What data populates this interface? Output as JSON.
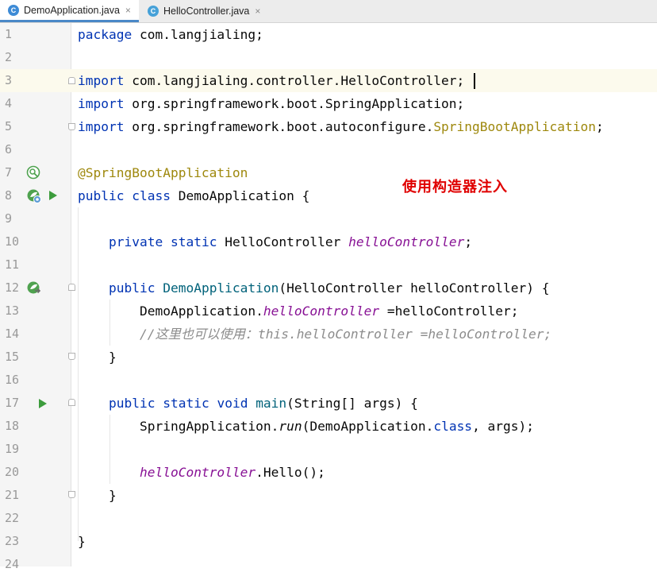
{
  "tabs": [
    {
      "label": "DemoApplication.java",
      "active": true,
      "icon": "spring-boot-class-icon",
      "close": "×"
    },
    {
      "label": "HelloController.java",
      "active": false,
      "icon": "java-class-icon",
      "close": "×"
    }
  ],
  "colors": {
    "keyword": "#0033b3",
    "annotation": "#9e880d",
    "field": "#871094",
    "method": "#00627a",
    "comment": "#8c8c8c",
    "note": "#e00000",
    "spring_icon": "#4fa24f",
    "run_icon": "#3c9c3c"
  },
  "editor": {
    "current_line": 3,
    "lines": [
      {
        "n": "1",
        "segs": [
          {
            "t": "package",
            "c": "kw"
          },
          {
            "t": " com.langjialing;"
          }
        ]
      },
      {
        "n": "2",
        "segs": []
      },
      {
        "n": "3",
        "segs": [
          {
            "t": "import",
            "c": "kw"
          },
          {
            "t": " com.langjialing.controller.HelloController;"
          }
        ]
      },
      {
        "n": "4",
        "segs": [
          {
            "t": "import",
            "c": "kw"
          },
          {
            "t": " org.springframework.boot.SpringApplication;"
          }
        ]
      },
      {
        "n": "5",
        "segs": [
          {
            "t": "import",
            "c": "kw"
          },
          {
            "t": " org.springframework.boot.autoconfigure."
          },
          {
            "t": "SpringBootApplication",
            "c": "ann"
          },
          {
            "t": ";"
          }
        ]
      },
      {
        "n": "6",
        "segs": []
      },
      {
        "n": "7",
        "segs": [
          {
            "t": "@SpringBootApplication",
            "c": "ann"
          }
        ]
      },
      {
        "n": "8",
        "segs": [
          {
            "t": "public",
            "c": "kw"
          },
          {
            "t": " "
          },
          {
            "t": "class",
            "c": "kw"
          },
          {
            "t": " DemoApplication {"
          }
        ]
      },
      {
        "n": "9",
        "segs": []
      },
      {
        "n": "10",
        "segs": [
          {
            "t": "    "
          },
          {
            "t": "private",
            "c": "kw"
          },
          {
            "t": " "
          },
          {
            "t": "static",
            "c": "kw"
          },
          {
            "t": " HelloController "
          },
          {
            "t": "helloController",
            "c": "fld"
          },
          {
            "t": ";"
          }
        ]
      },
      {
        "n": "11",
        "segs": []
      },
      {
        "n": "12",
        "segs": [
          {
            "t": "    "
          },
          {
            "t": "public",
            "c": "kw"
          },
          {
            "t": " "
          },
          {
            "t": "DemoApplication",
            "c": "fn"
          },
          {
            "t": "(HelloController helloController) {"
          }
        ]
      },
      {
        "n": "13",
        "segs": [
          {
            "t": "        DemoApplication."
          },
          {
            "t": "helloController",
            "c": "fld"
          },
          {
            "t": " =helloController;"
          }
        ]
      },
      {
        "n": "14",
        "segs": [
          {
            "t": "        "
          },
          {
            "t": "//这里也可以使用：this.helloController =helloController;",
            "c": "cmt"
          }
        ]
      },
      {
        "n": "15",
        "segs": [
          {
            "t": "    }"
          }
        ]
      },
      {
        "n": "16",
        "segs": []
      },
      {
        "n": "17",
        "segs": [
          {
            "t": "    "
          },
          {
            "t": "public",
            "c": "kw"
          },
          {
            "t": " "
          },
          {
            "t": "static",
            "c": "kw"
          },
          {
            "t": " "
          },
          {
            "t": "void",
            "c": "kw"
          },
          {
            "t": " "
          },
          {
            "t": "main",
            "c": "fn"
          },
          {
            "t": "(String[] args) {"
          }
        ]
      },
      {
        "n": "18",
        "segs": [
          {
            "t": "        SpringApplication."
          },
          {
            "t": "run",
            "c": "it"
          },
          {
            "t": "(DemoApplication."
          },
          {
            "t": "class",
            "c": "kw"
          },
          {
            "t": ", args);"
          }
        ]
      },
      {
        "n": "19",
        "segs": []
      },
      {
        "n": "20",
        "segs": [
          {
            "t": "        "
          },
          {
            "t": "helloController",
            "c": "fld"
          },
          {
            "t": ".Hello();"
          }
        ]
      },
      {
        "n": "21",
        "segs": [
          {
            "t": "    }"
          }
        ]
      },
      {
        "n": "22",
        "segs": []
      },
      {
        "n": "23",
        "segs": [
          {
            "t": "}"
          }
        ]
      },
      {
        "n": "24",
        "segs": []
      }
    ]
  },
  "gutter_icons": {
    "7": [
      "spring-bean-icon"
    ],
    "8": [
      "spring-app-icon",
      "run-icon"
    ],
    "12": [
      "spring-autowired-icon"
    ],
    "17": [
      "run-icon"
    ]
  },
  "note": "使用构造器注入"
}
